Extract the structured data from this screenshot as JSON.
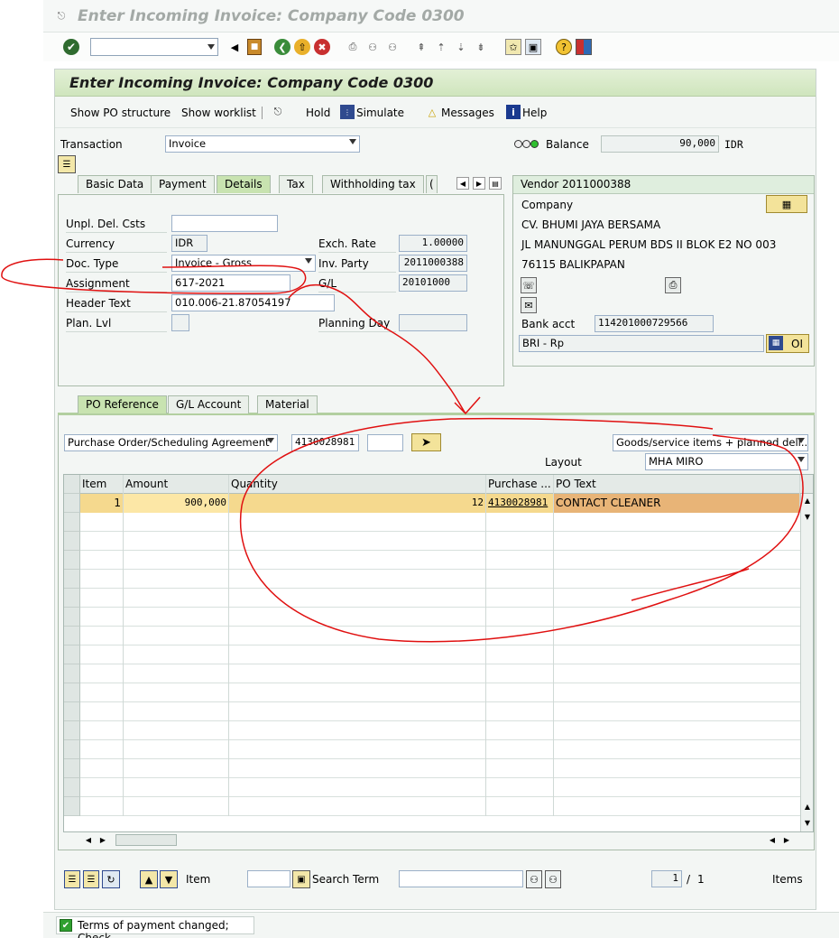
{
  "window": {
    "title": "Enter Incoming Invoice: Company Code 0300"
  },
  "header": {
    "title": "Enter Incoming Invoice: Company Code 0300"
  },
  "apptoolbar": {
    "show_po_structure": "Show PO structure",
    "show_worklist": "Show worklist",
    "hold": "Hold",
    "simulate": "Simulate",
    "messages": "Messages",
    "help": "Help"
  },
  "transaction": {
    "label": "Transaction",
    "value": "Invoice"
  },
  "balance": {
    "label": "Balance",
    "value": "90,000",
    "currency": "IDR"
  },
  "tabs": [
    "Basic Data",
    "Payment",
    "Details",
    "Tax",
    "Withholding tax",
    "("
  ],
  "details": {
    "unpl_del_csts": {
      "label": "Unpl. Del. Csts",
      "value": ""
    },
    "currency": {
      "label": "Currency",
      "value": "IDR"
    },
    "exch_rate": {
      "label": "Exch. Rate",
      "value": "1.00000"
    },
    "doc_type": {
      "label": "Doc. Type",
      "value": "Invoice - Gross"
    },
    "inv_party": {
      "label": "Inv. Party",
      "value": "2011000388"
    },
    "assignment": {
      "label": "Assignment",
      "value": "617-2021"
    },
    "gl": {
      "label": "G/L",
      "value": "20101000"
    },
    "header_text": {
      "label": "Header Text",
      "value": "010.006-21.87054197"
    },
    "plan_lvl": {
      "label": "Plan. Lvl",
      "value": ""
    },
    "planning_day": {
      "label": "Planning Day",
      "value": ""
    }
  },
  "vendor": {
    "title": "Vendor 2011000388",
    "company": "Company",
    "name": "CV. BHUMI JAYA BERSAMA",
    "address": "JL MANUNGGAL PERUM BDS II BLOK E2 NO 003",
    "city": "76115 BALIKPAPAN",
    "bank_acct_label": "Bank acct",
    "bank_acct": "114201000729566",
    "bank_name": "BRI - Rp",
    "oi_label": "OI"
  },
  "po_tabs": [
    "PO Reference",
    "G/L Account",
    "Material"
  ],
  "po_reference": {
    "ref_type": "Purchase Order/Scheduling Agreement",
    "po_number": "4130028981",
    "item": "",
    "goods_service": "Goods/service items + planned deli...",
    "layout_label": "Layout",
    "layout": "MHA MIRO"
  },
  "table": {
    "columns": [
      "Item",
      "Amount",
      "Quantity",
      "Purchase ...",
      "PO Text"
    ],
    "rows": [
      {
        "item": "1",
        "amount": "900,000",
        "quantity": "12",
        "po": "4130028981",
        "text": "CONTACT CLEANER"
      }
    ]
  },
  "bottom": {
    "item_label": "Item",
    "item_value": "",
    "search_term_label": "Search Term",
    "search_term_value": "",
    "page_current": "1",
    "page_sep": "/",
    "page_total": "1",
    "items_label": "Items"
  },
  "status": {
    "message": "Terms of payment changed; Check"
  }
}
